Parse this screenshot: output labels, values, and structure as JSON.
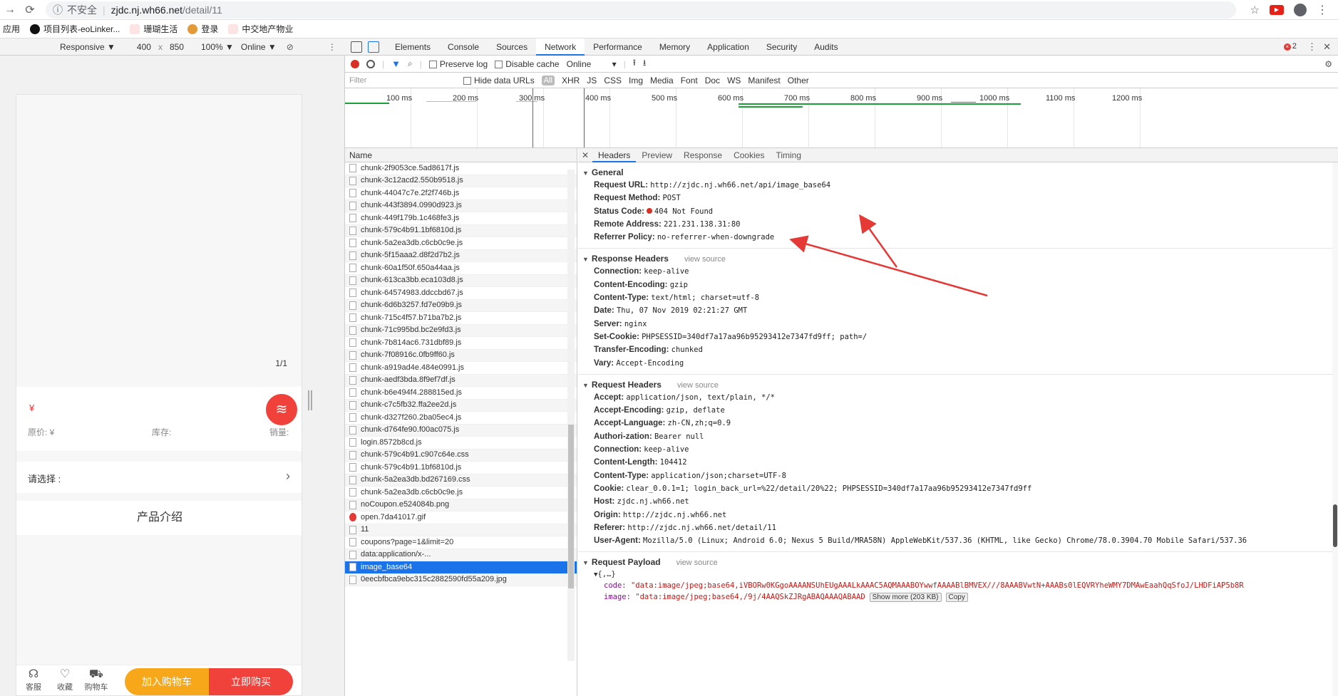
{
  "browser": {
    "insecure_label": "不安全",
    "url_host": "zjdc.nj.wh66.net",
    "url_path": "/detail/11",
    "star_icon": "star-icon",
    "bookmarks": [
      {
        "label": "应用",
        "color": "#4285f4"
      },
      {
        "label": "项目列表-eoLinker...",
        "color": "#111111"
      },
      {
        "label": "珊瑚生活",
        "color": "#e53935"
      },
      {
        "label": "登录",
        "color": "#e59a3a"
      },
      {
        "label": "中交地产物业",
        "color": "#e53935"
      }
    ]
  },
  "device_toolbar": {
    "mode": "Responsive ▼",
    "width": "400",
    "times": "x",
    "height": "850",
    "zoom": "100% ▼",
    "network": "Online ▼"
  },
  "phone": {
    "pager": "1/1",
    "yen": "¥",
    "orig_price": "原价: ¥",
    "stock": "库存:",
    "sales": "销量:",
    "choose_label": "请选择 :",
    "intro": "产品介绍",
    "bottom": {
      "service": "客服",
      "favorite": "收藏",
      "cart": "购物车",
      "add_cart": "加入购物车",
      "buy_now": "立即购买"
    }
  },
  "devtools": {
    "tabs": [
      "Elements",
      "Console",
      "Sources",
      "Network",
      "Performance",
      "Memory",
      "Application",
      "Security",
      "Audits"
    ],
    "active_tab": "Network",
    "error_count": "2",
    "net_toolbar": {
      "preserve_log": "Preserve log",
      "disable_cache": "Disable cache",
      "throttle": "Online"
    },
    "filter": {
      "placeholder": "Filter",
      "hide_data_urls": "Hide data URLs",
      "types": [
        "All",
        "XHR",
        "JS",
        "CSS",
        "Img",
        "Media",
        "Font",
        "Doc",
        "WS",
        "Manifest",
        "Other"
      ]
    },
    "timeline_ticks": [
      "100 ms",
      "200 ms",
      "300 ms",
      "400 ms",
      "500 ms",
      "600 ms",
      "700 ms",
      "800 ms",
      "900 ms",
      "1000 ms",
      "1100 ms",
      "1200 ms"
    ],
    "list_header": "Name",
    "requests": [
      {
        "name": "chunk-2f9053ce.5ad8617f.js"
      },
      {
        "name": "chunk-3c12acd2.550b9518.js"
      },
      {
        "name": "chunk-44047c7e.2f2f746b.js"
      },
      {
        "name": "chunk-443f3894.0990d923.js"
      },
      {
        "name": "chunk-449f179b.1c468fe3.js"
      },
      {
        "name": "chunk-579c4b91.1bf6810d.js"
      },
      {
        "name": "chunk-5a2ea3db.c6cb0c9e.js"
      },
      {
        "name": "chunk-5f15aaa2.d8f2d7b2.js"
      },
      {
        "name": "chunk-60a1f50f.650a44aa.js"
      },
      {
        "name": "chunk-613ca3bb.eca103d8.js"
      },
      {
        "name": "chunk-64574983.ddccbd67.js"
      },
      {
        "name": "chunk-6d6b3257.fd7e09b9.js"
      },
      {
        "name": "chunk-715c4f57.b71ba7b2.js"
      },
      {
        "name": "chunk-71c995bd.bc2e9fd3.js"
      },
      {
        "name": "chunk-7b814ac6.731dbf89.js"
      },
      {
        "name": "chunk-7f08916c.0fb9ff60.js"
      },
      {
        "name": "chunk-a919ad4e.484e0991.js"
      },
      {
        "name": "chunk-aedf3bda.8f9ef7df.js"
      },
      {
        "name": "chunk-b6e494f4.288815ed.js"
      },
      {
        "name": "chunk-c7c5fb32.ffa2ee2d.js"
      },
      {
        "name": "chunk-d327f260.2ba05ec4.js"
      },
      {
        "name": "chunk-d764fe90.f00ac075.js"
      },
      {
        "name": "login.8572b8cd.js"
      },
      {
        "name": "chunk-579c4b91.c907c64e.css"
      },
      {
        "name": "chunk-579c4b91.1bf6810d.js"
      },
      {
        "name": "chunk-5a2ea3db.bd267169.css"
      },
      {
        "name": "chunk-5a2ea3db.c6cb0c9e.js"
      },
      {
        "name": "noCoupon.e524084b.png"
      },
      {
        "name": "open.7da41017.gif"
      },
      {
        "name": "11"
      },
      {
        "name": "coupons?page=1&limit=20"
      },
      {
        "name": "data:application/x-..."
      },
      {
        "name": "image_base64"
      },
      {
        "name": "0eecbfbca9ebc315c2882590fd55a209.jpg"
      }
    ],
    "selected_request": "image_base64",
    "detail_tabs": [
      "Headers",
      "Preview",
      "Response",
      "Cookies",
      "Timing"
    ],
    "general": {
      "title": "General",
      "request_url_k": "Request URL:",
      "request_url_v": "http://zjdc.nj.wh66.net/api/image_base64",
      "method_k": "Request Method:",
      "method_v": "POST",
      "status_k": "Status Code:",
      "status_v": "404 Not Found",
      "remote_k": "Remote Address:",
      "remote_v": "221.231.138.31:80",
      "referrer_k": "Referrer Policy:",
      "referrer_v": "no-referrer-when-downgrade"
    },
    "response_headers": {
      "title": "Response Headers",
      "view_source": "view source",
      "rows": [
        {
          "k": "Connection:",
          "v": "keep-alive"
        },
        {
          "k": "Content-Encoding:",
          "v": "gzip"
        },
        {
          "k": "Content-Type:",
          "v": "text/html; charset=utf-8"
        },
        {
          "k": "Date:",
          "v": "Thu, 07 Nov 2019 02:21:27 GMT"
        },
        {
          "k": "Server:",
          "v": "nginx"
        },
        {
          "k": "Set-Cookie:",
          "v": "PHPSESSID=340df7a17aa96b95293412e7347fd9ff; path=/"
        },
        {
          "k": "Transfer-Encoding:",
          "v": "chunked"
        },
        {
          "k": "Vary:",
          "v": "Accept-Encoding"
        }
      ]
    },
    "request_headers": {
      "title": "Request Headers",
      "view_source": "view source",
      "rows": [
        {
          "k": "Accept:",
          "v": "application/json, text/plain, */*"
        },
        {
          "k": "Accept-Encoding:",
          "v": "gzip, deflate"
        },
        {
          "k": "Accept-Language:",
          "v": "zh-CN,zh;q=0.9"
        },
        {
          "k": "Authori-zation:",
          "v": "Bearer null"
        },
        {
          "k": "Connection:",
          "v": "keep-alive"
        },
        {
          "k": "Content-Length:",
          "v": "104412"
        },
        {
          "k": "Content-Type:",
          "v": "application/json;charset=UTF-8"
        },
        {
          "k": "Cookie:",
          "v": "clear_0.0.1=1; login_back_url=%22/detail/20%22; PHPSESSID=340df7a17aa96b95293412e7347fd9ff"
        },
        {
          "k": "Host:",
          "v": "zjdc.nj.wh66.net"
        },
        {
          "k": "Origin:",
          "v": "http://zjdc.nj.wh66.net"
        },
        {
          "k": "Referer:",
          "v": "http://zjdc.nj.wh66.net/detail/11"
        },
        {
          "k": "User-Agent:",
          "v": "Mozilla/5.0 (Linux; Android 6.0; Nexus 5 Build/MRA58N) AppleWebKit/537.36 (KHTML, like Gecko) Chrome/78.0.3904.70 Mobile Safari/537.36"
        }
      ]
    },
    "payload": {
      "title": "Request Payload",
      "view_source": "view source",
      "obj": "{,…}",
      "code_k": "code:",
      "code_v": "\"data:image/jpeg;base64,iVBORw0KGgoAAAANSUhEUgAAALkAAAC5AQMAAABOYwwfAAAABlBMVEX///8AAABVwtN+AAABs0lEQVRYheWMY7DMAwEaahQqSfoJ/LHDFiAP5b8R",
      "image_k": "image:",
      "image_v": "\"data:image/jpeg;base64,/9j/4AAQSkZJRgABAQAAAQABAAD",
      "show_more": "Show more (203 KB)",
      "copy": "Copy"
    }
  }
}
